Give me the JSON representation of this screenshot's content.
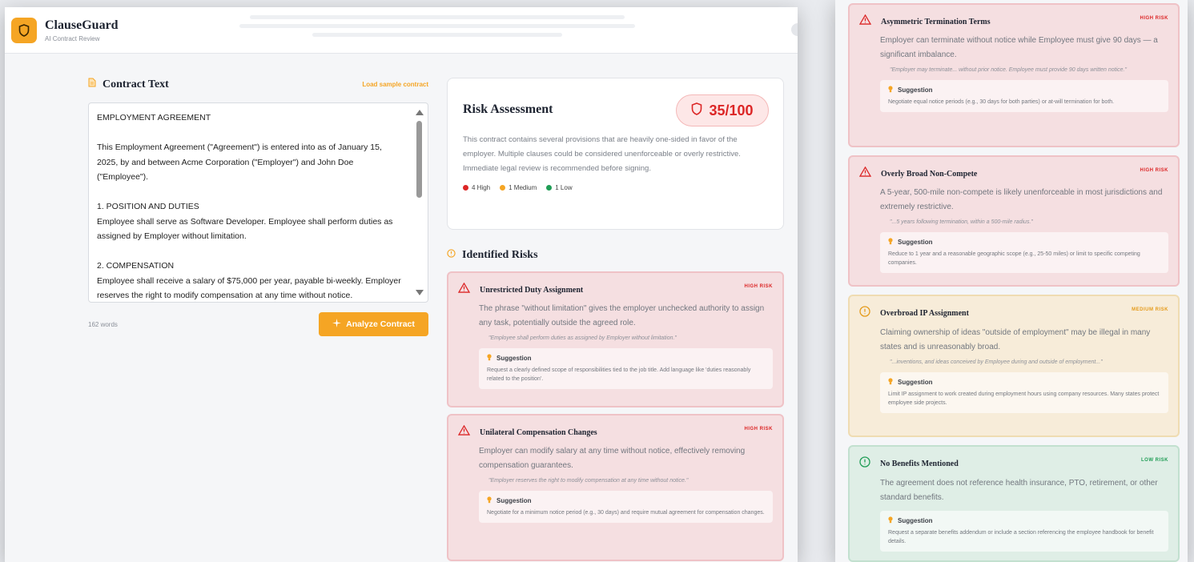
{
  "app": {
    "name": "ClauseGuard",
    "subtitle": "AI Contract Review"
  },
  "contract": {
    "section_title": "Contract Text",
    "sample_link": "Load sample contract",
    "text": "EMPLOYMENT AGREEMENT\n\nThis Employment Agreement (\"Agreement\") is entered into as of January 15, 2025, by and between Acme Corporation (\"Employer\") and John Doe (\"Employee\").\n\n1. POSITION AND DUTIES\nEmployee shall serve as Software Developer. Employee shall perform duties as assigned by Employer without limitation.\n\n2. COMPENSATION\nEmployee shall receive a salary of $75,000 per year, payable bi-weekly. Employer reserves the right to modify compensation at any time without notice.",
    "word_count": "162 words",
    "analyze_button": "Analyze Contract"
  },
  "assessment": {
    "title": "Risk Assessment",
    "score": "35/100",
    "summary": "This contract contains several provisions that are heavily one-sided in favor of the employer. Multiple clauses could be considered unenforceable or overly restrictive. Immediate legal review is recommended before signing.",
    "legend": [
      {
        "label": "4 High",
        "color": "#dc2626"
      },
      {
        "label": "1 Medium",
        "color": "#f5a524"
      },
      {
        "label": "1 Low",
        "color": "#1f9d55"
      }
    ]
  },
  "identified_risks_title": "Identified Risks",
  "suggestion_label": "Suggestion",
  "risks": [
    {
      "title": "Unrestricted Duty Assignment",
      "level": "HIGH RISK",
      "description": "The phrase \"without limitation\" gives the employer unchecked authority to assign any task, potentially outside the agreed role.",
      "quote": "\"Employee shall perform duties as assigned by Employer without limitation.\"",
      "suggestion": "Request a clearly defined scope of responsibilities tied to the job title. Add language like 'duties reasonably related to the position'."
    },
    {
      "title": "Unilateral Compensation Changes",
      "level": "HIGH RISK",
      "description": "Employer can modify salary at any time without notice, effectively removing compensation guarantees.",
      "quote": "\"Employer reserves the right to modify compensation at any time without notice.\"",
      "suggestion": "Negotiate for a minimum notice period (e.g., 30 days) and require mutual agreement for compensation changes."
    },
    {
      "title": "Asymmetric Termination Terms",
      "level": "HIGH RISK",
      "description": "Employer can terminate without notice while Employee must give 90 days — a significant imbalance.",
      "quote": "\"Employer may terminate... without prior notice. Employee must provide 90 days written notice.\"",
      "suggestion": "Negotiate equal notice periods (e.g., 30 days for both parties) or at-will termination for both."
    },
    {
      "title": "Overly Broad Non-Compete",
      "level": "HIGH RISK",
      "description": "A 5-year, 500-mile non-compete is likely unenforceable in most jurisdictions and extremely restrictive.",
      "quote": "\"...5 years following termination, within a 500-mile radius.\"",
      "suggestion": "Reduce to 1 year and a reasonable geographic scope (e.g., 25-50 miles) or limit to specific competing companies."
    },
    {
      "title": "Overbroad IP Assignment",
      "level": "MEDIUM RISK",
      "description": "Claiming ownership of ideas \"outside of employment\" may be illegal in many states and is unreasonably broad.",
      "quote": "\"...inventions, and ideas conceived by Employee during and outside of employment...\"",
      "suggestion": "Limit IP assignment to work created during employment hours using company resources. Many states protect employee side projects."
    },
    {
      "title": "No Benefits Mentioned",
      "level": "LOW RISK",
      "description": "The agreement does not reference health insurance, PTO, retirement, or other standard benefits.",
      "quote": "",
      "suggestion": "Request a separate benefits addendum or include a section referencing the employee handbook for benefit details."
    }
  ]
}
